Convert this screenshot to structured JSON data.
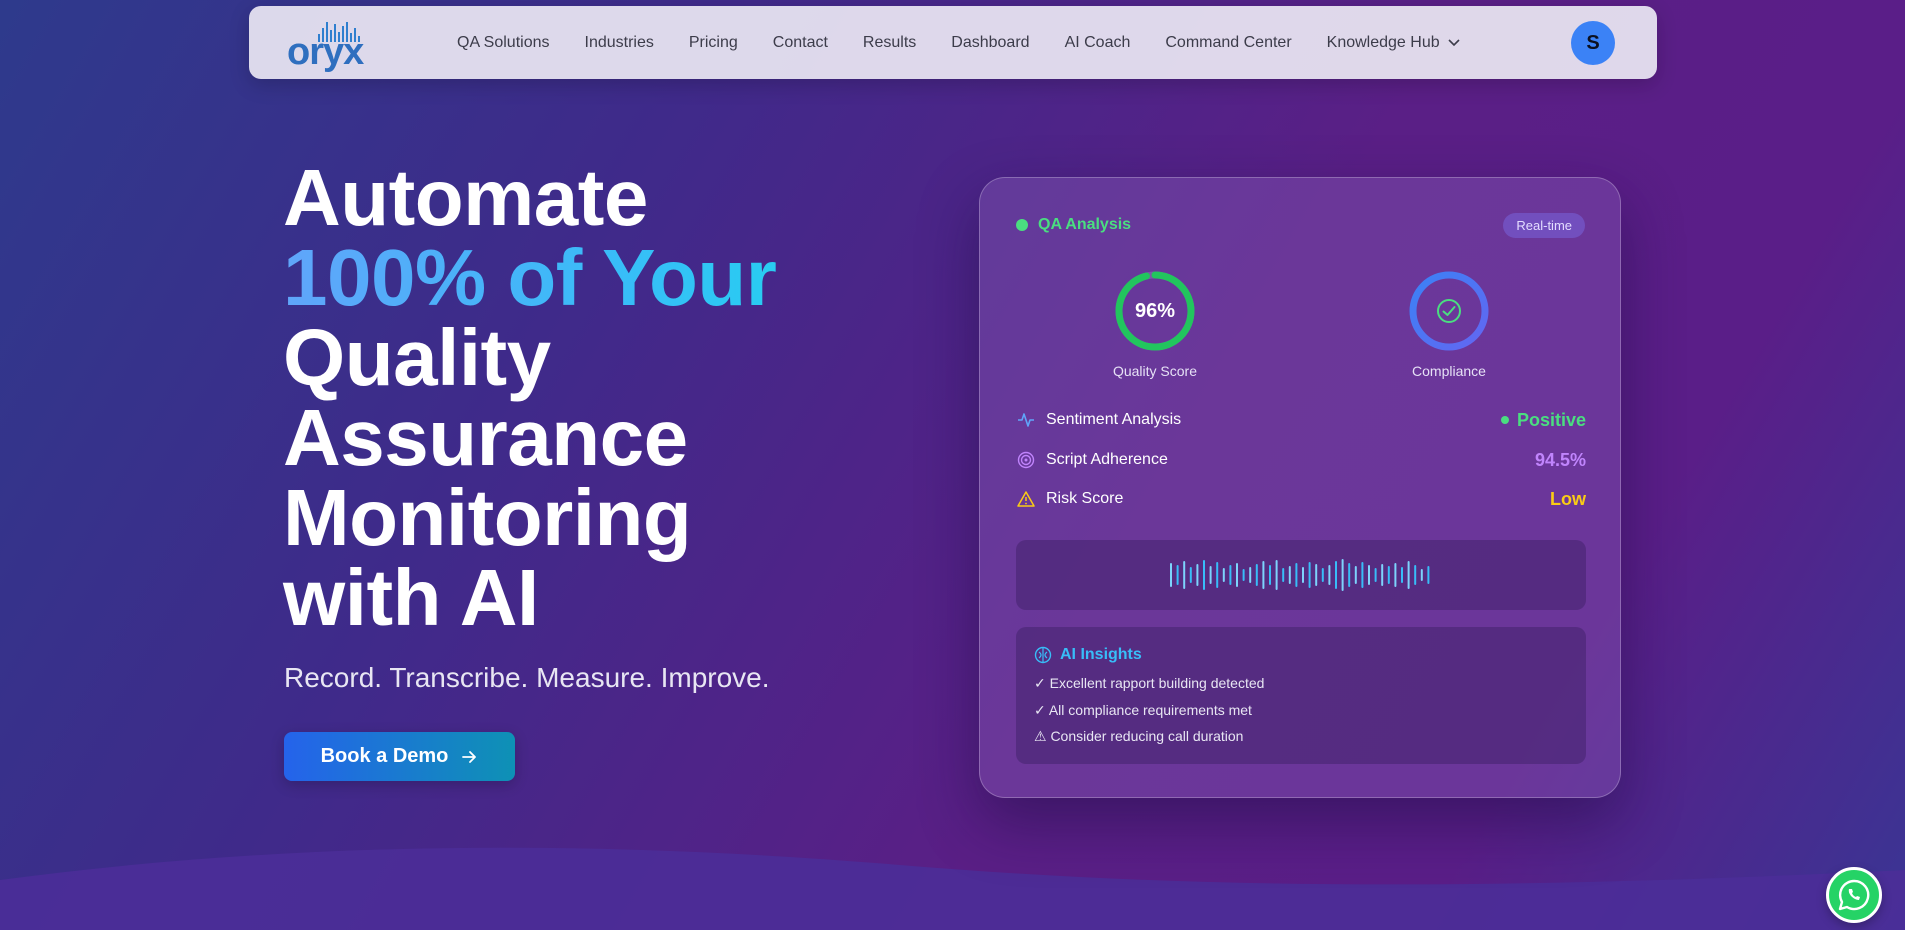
{
  "nav": {
    "logo_text": "oryx",
    "links": [
      {
        "label": "QA Solutions"
      },
      {
        "label": "Industries"
      },
      {
        "label": "Pricing"
      },
      {
        "label": "Contact"
      },
      {
        "label": "Results"
      },
      {
        "label": "Dashboard"
      },
      {
        "label": "AI Coach"
      },
      {
        "label": "Command Center"
      },
      {
        "label": "Knowledge Hub",
        "icon": "chevron-down-icon"
      }
    ],
    "avatar_initial": "S"
  },
  "hero": {
    "line1": "Automate",
    "line2_accent": "100% of Your",
    "line3": "Quality",
    "line4": "Assurance",
    "line5": "Monitoring",
    "line6": "with AI",
    "tagline": "Record. Transcribe. Measure. Improve.",
    "cta_label": "Book a Demo",
    "cta_icon": "arrow-right-icon"
  },
  "card": {
    "title": "QA Analysis",
    "badge": "Real-time",
    "quality_score": {
      "value": "96%",
      "label": "Quality Score",
      "fraction": 0.96,
      "color": "#22c55e"
    },
    "compliance": {
      "label": "Compliance",
      "icon": "check-circle-icon",
      "fraction": 1.0
    },
    "metrics": [
      {
        "label": "Sentiment Analysis",
        "value": "Positive",
        "icon": "activity-icon",
        "color": "#4ade80"
      },
      {
        "label": "Script Adherence",
        "value": "94.5%",
        "icon": "target-icon",
        "color": "#c084fc"
      },
      {
        "label": "Risk Score",
        "value": "Low",
        "icon": "warning-icon",
        "color": "#facc15"
      }
    ],
    "insights": {
      "title": "AI Insights",
      "icon": "brain-icon",
      "lines": [
        "✓ Excellent rapport building detected",
        "✓ All compliance requirements met",
        "⚠ Consider reducing call duration"
      ]
    }
  },
  "floating": {
    "whatsapp_icon": "whatsapp-icon"
  },
  "colors": {
    "accent_blue": "#3b82f6",
    "green": "#4ade80",
    "purple": "#c084fc",
    "yellow": "#facc15",
    "cyan": "#38bdf8"
  }
}
